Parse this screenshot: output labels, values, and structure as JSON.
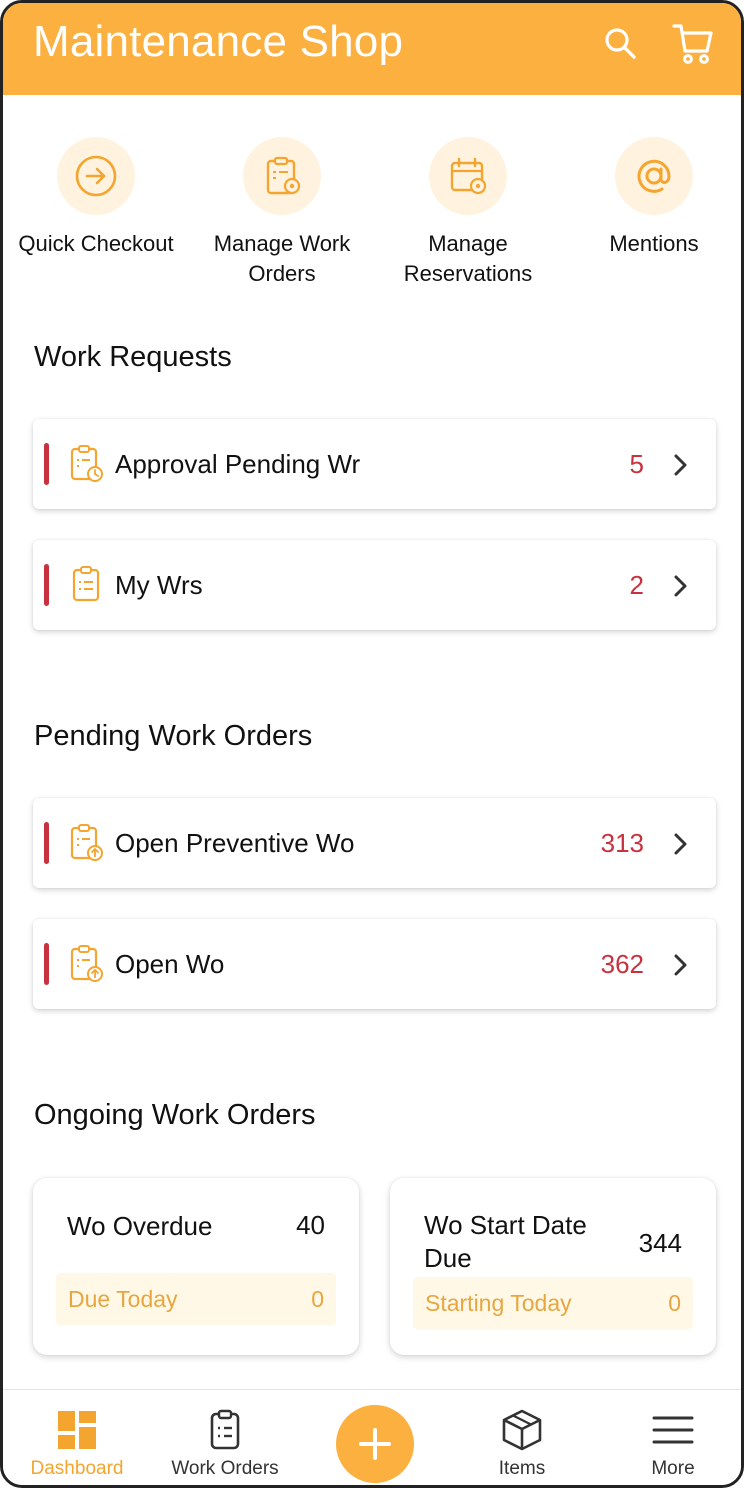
{
  "header": {
    "title": "Maintenance Shop",
    "search_icon": "search-icon",
    "cart_icon": "cart-icon"
  },
  "quick_actions": [
    {
      "label": "Quick Checkout",
      "icon": "arrow-circle-right-icon"
    },
    {
      "label": "Manage Work Orders",
      "icon": "clipboard-gear-icon"
    },
    {
      "label": "Manage Reservations",
      "icon": "calendar-gear-icon"
    },
    {
      "label": "Mentions",
      "icon": "at-sign-icon"
    }
  ],
  "work_requests": {
    "title": "Work Requests",
    "items": [
      {
        "label": "Approval Pending Wr",
        "count": "5",
        "icon": "clipboard-clock-icon"
      },
      {
        "label": "My Wrs",
        "count": "2",
        "icon": "clipboard-list-icon"
      }
    ]
  },
  "pending_work_orders": {
    "title": "Pending Work Orders",
    "items": [
      {
        "label": "Open Preventive Wo",
        "count": "313",
        "icon": "clipboard-upload-icon"
      },
      {
        "label": "Open Wo",
        "count": "362",
        "icon": "clipboard-upload-icon"
      }
    ]
  },
  "ongoing_work_orders": {
    "title": "Ongoing Work Orders",
    "tiles": [
      {
        "title": "Wo Overdue",
        "count": "40",
        "sub_label": "Due Today",
        "sub_count": "0"
      },
      {
        "title": "Wo Start Date Due",
        "count": "344",
        "sub_label": "Starting Today",
        "sub_count": "0"
      }
    ]
  },
  "bottom_nav": [
    {
      "label": "Dashboard",
      "icon": "dashboard-icon",
      "active": true
    },
    {
      "label": "Work Orders",
      "icon": "clipboard-icon",
      "active": false
    },
    {
      "label": "",
      "icon": "plus-icon",
      "active": false
    },
    {
      "label": "Items",
      "icon": "box-icon",
      "active": false
    },
    {
      "label": "More",
      "icon": "menu-icon",
      "active": false
    }
  ],
  "colors": {
    "accent": "#fbb040",
    "accent_light": "#fff3df",
    "count_red": "#c8323e",
    "sub_text": "#e7a640"
  }
}
